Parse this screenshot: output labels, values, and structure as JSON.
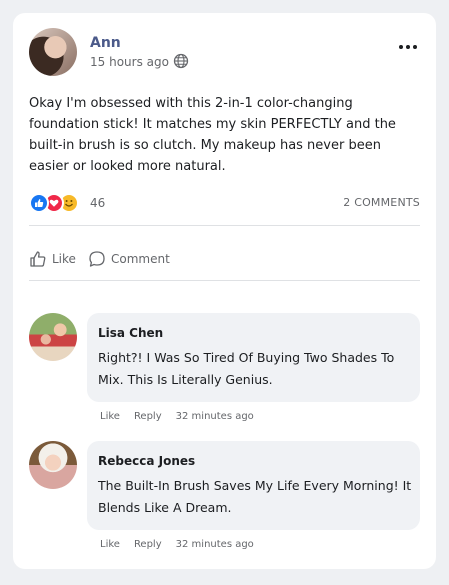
{
  "post": {
    "author": "Ann",
    "time": "15 hours ago",
    "text": "Okay I'm obsessed with this 2-in-1 color-changing foundation stick! It matches my skin PERFECTLY and the built-in brush is so clutch. My makeup has never been easier or looked more natural.",
    "reaction_count": "46",
    "comments_count": "2 COMMENTS",
    "reactions": [
      "like",
      "love",
      "haha"
    ]
  },
  "actions": {
    "like": "Like",
    "comment": "Comment"
  },
  "comments": [
    {
      "name": "Lisa Chen",
      "text": "Right?! I Was So Tired Of Buying Two Shades To Mix. This Is Literally Genius.",
      "like": "Like",
      "reply": "Reply",
      "time": "32 minutes ago"
    },
    {
      "name": "Rebecca Jones",
      "text": "The Built-In Brush Saves My Life Every Morning! It Blends Like A Dream.",
      "like": "Like",
      "reply": "Reply",
      "time": "32 minutes ago"
    }
  ],
  "colors": {
    "author_name": "#4b5a8a",
    "like_reaction": "#1877f2",
    "love_reaction": "#f02849",
    "haha_reaction": "#f7b928"
  }
}
